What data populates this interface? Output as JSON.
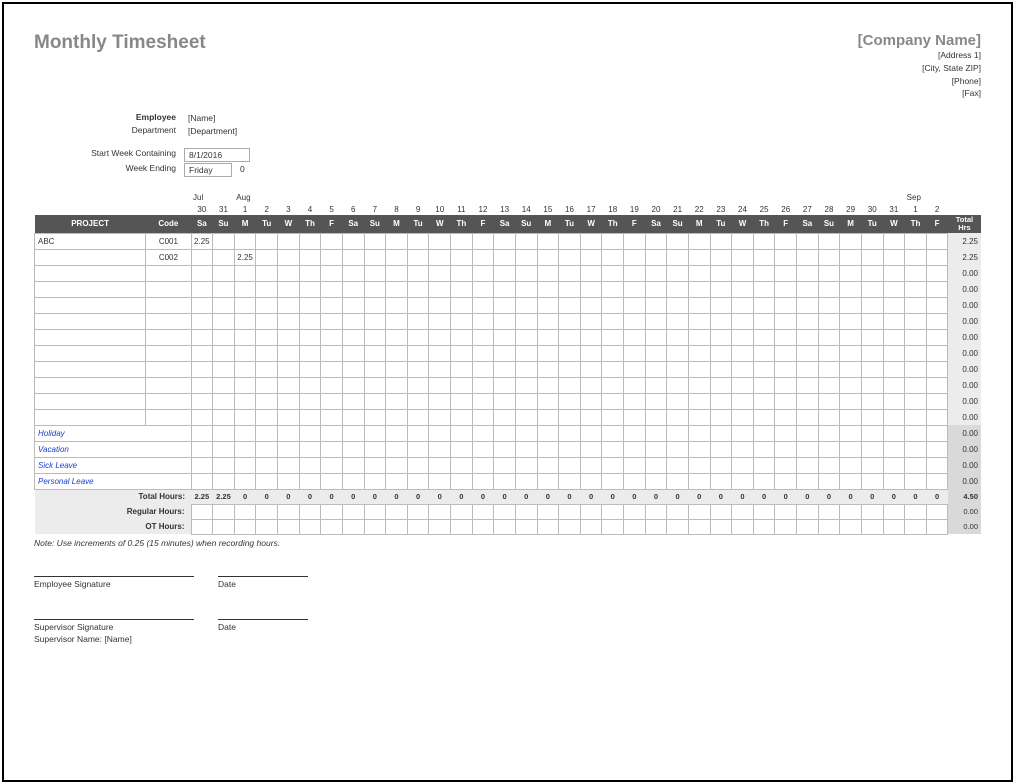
{
  "title": "Monthly Timesheet",
  "company": {
    "name": "[Company Name]",
    "address": "[Address 1]",
    "citystatezip": "[City, State ZIP]",
    "phone": "[Phone]",
    "fax": "[Fax]"
  },
  "meta": {
    "employee_label": "Employee",
    "employee_value": "[Name]",
    "department_label": "Department",
    "department_value": "[Department]",
    "start_label": "Start Week Containing",
    "start_value": "8/1/2016",
    "weekending_label": "Week Ending",
    "weekending_value": "Friday",
    "weekending_after": "0"
  },
  "months": [
    "Jul",
    "",
    "Aug",
    "",
    "",
    "",
    "",
    "",
    "",
    "",
    "",
    "",
    "",
    "",
    "",
    "",
    "",
    "",
    "",
    "",
    "",
    "",
    "",
    "",
    "",
    "",
    "",
    "",
    "",
    "",
    "",
    "",
    "",
    "Sep",
    ""
  ],
  "daynums": [
    "30",
    "31",
    "1",
    "2",
    "3",
    "4",
    "5",
    "6",
    "7",
    "8",
    "9",
    "10",
    "11",
    "12",
    "13",
    "14",
    "15",
    "16",
    "17",
    "18",
    "19",
    "20",
    "21",
    "22",
    "23",
    "24",
    "25",
    "26",
    "27",
    "28",
    "29",
    "30",
    "31",
    "1",
    "2"
  ],
  "dow": [
    "Sa",
    "Su",
    "M",
    "Tu",
    "W",
    "Th",
    "F",
    "Sa",
    "Su",
    "M",
    "Tu",
    "W",
    "Th",
    "F",
    "Sa",
    "Su",
    "M",
    "Tu",
    "W",
    "Th",
    "F",
    "Sa",
    "Su",
    "M",
    "Tu",
    "W",
    "Th",
    "F",
    "Sa",
    "Su",
    "M",
    "Tu",
    "W",
    "Th",
    "F"
  ],
  "hdr": {
    "project": "PROJECT",
    "code": "Code",
    "total": "Total\nHrs"
  },
  "rows": [
    {
      "project": "ABC",
      "code": "C001",
      "cells": {
        "0": "2.25"
      },
      "total": "2.25"
    },
    {
      "project": "",
      "code": "C002",
      "cells": {
        "2": "2.25"
      },
      "total": "2.25"
    },
    {
      "project": "",
      "code": "",
      "cells": {},
      "total": "0.00"
    },
    {
      "project": "",
      "code": "",
      "cells": {},
      "total": "0.00"
    },
    {
      "project": "",
      "code": "",
      "cells": {},
      "total": "0.00"
    },
    {
      "project": "",
      "code": "",
      "cells": {},
      "total": "0.00"
    },
    {
      "project": "",
      "code": "",
      "cells": {},
      "total": "0.00"
    },
    {
      "project": "",
      "code": "",
      "cells": {},
      "total": "0.00"
    },
    {
      "project": "",
      "code": "",
      "cells": {},
      "total": "0.00"
    },
    {
      "project": "",
      "code": "",
      "cells": {},
      "total": "0.00"
    },
    {
      "project": "",
      "code": "",
      "cells": {},
      "total": "0.00"
    },
    {
      "project": "",
      "code": "",
      "cells": {},
      "total": "0.00"
    }
  ],
  "leave_rows": [
    {
      "project": "Holiday",
      "total": "0.00"
    },
    {
      "project": "Vacation",
      "total": "0.00"
    },
    {
      "project": "Sick Leave",
      "total": "0.00"
    },
    {
      "project": "Personal Leave",
      "total": "0.00"
    }
  ],
  "totals": {
    "total_hours_label": "Total Hours:",
    "total_hours": [
      "2.25",
      "2.25",
      "0",
      "0",
      "0",
      "0",
      "0",
      "0",
      "0",
      "0",
      "0",
      "0",
      "0",
      "0",
      "0",
      "0",
      "0",
      "0",
      "0",
      "0",
      "0",
      "0",
      "0",
      "0",
      "0",
      "0",
      "0",
      "0",
      "0",
      "0",
      "0",
      "0",
      "0",
      "0",
      "0"
    ],
    "total_hours_grand": "4.50",
    "regular_label": "Regular Hours:",
    "regular_grand": "0.00",
    "ot_label": "OT Hours:",
    "ot_grand": "0.00"
  },
  "note": "Note: Use increments of 0.25 (15 minutes) when recording hours.",
  "sig": {
    "emp": "Employee Signature",
    "date": "Date",
    "sup": "Supervisor Signature",
    "sup_name_label": "Supervisor Name:",
    "sup_name_value": "[Name]"
  }
}
